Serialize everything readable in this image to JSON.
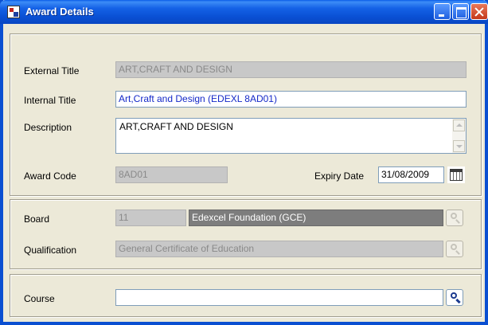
{
  "window": {
    "title": "Award Details"
  },
  "details": {
    "external_title_label": "External Title",
    "external_title_value": "ART,CRAFT AND DESIGN",
    "internal_title_label": "Internal Title",
    "internal_title_value": "Art,Craft and Design (EDEXL 8AD01)",
    "description_label": "Description",
    "description_value": "ART,CRAFT AND DESIGN",
    "award_code_label": "Award Code",
    "award_code_value": "8AD01",
    "expiry_date_label": "Expiry Date",
    "expiry_date_value": "31/08/2009"
  },
  "board_section": {
    "board_label": "Board",
    "board_code": "11",
    "board_name": "Edexcel Foundation (GCE)",
    "qualification_label": "Qualification",
    "qualification_value": "General Certificate of Education"
  },
  "course_section": {
    "course_label": "Course",
    "course_value": ""
  },
  "icons": {
    "app": "app-icon",
    "calendar": "calendar-icon",
    "lookup": "magnifier-icon"
  }
}
